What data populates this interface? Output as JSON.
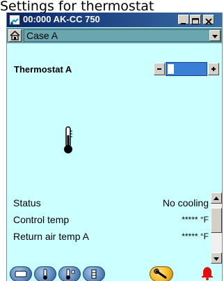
{
  "caption": "Settings for thermostat",
  "window": {
    "title": "00:000 AK-CC 750"
  },
  "case_select": {
    "value": "Case A"
  },
  "thermostat": {
    "label": "Thermostat A",
    "spinner": {
      "decrement_symbol": "-",
      "increment_symbol": "+"
    }
  },
  "status_rows": [
    {
      "label": "Status",
      "value": "No cooling"
    },
    {
      "label": "Control temp",
      "value": "***** °F"
    },
    {
      "label": "Return air temp A",
      "value": "***** °F"
    }
  ],
  "icons": {
    "window": "app-icon",
    "home": "home-icon",
    "thermometer": "thermometer-icon",
    "bottom_tools": [
      "case-icon",
      "thermostat-icon",
      "thermostat-settings-icon",
      "settings-icon",
      "wrench-icon",
      "alarm-bell-icon"
    ]
  },
  "colors": {
    "background": "#ccffff",
    "titlebar_start": "#0a246a",
    "titlebar_end": "#3a6ea5",
    "casebar": "#5f9aa3",
    "spinner_field": "#3a7fd6",
    "bell": "#e01010"
  }
}
